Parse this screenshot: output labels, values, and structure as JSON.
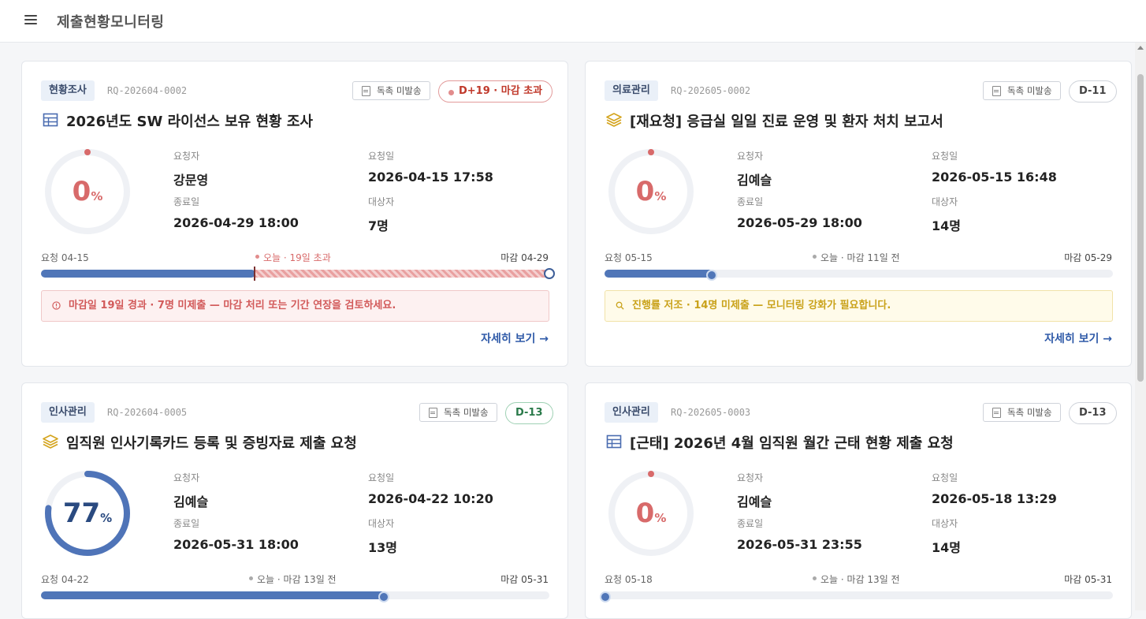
{
  "header": {
    "title": "제출현황모니터링",
    "menu_icon": "hamburger-menu-icon"
  },
  "common": {
    "doc_button": "독촉 미발송",
    "detail_link": "자세히 보기 →",
    "pct_unit": "%"
  },
  "cards": [
    {
      "category": "현황조사",
      "req_id": "RQ-202604-0002",
      "dday": "D+19 · 마감 초과",
      "title": "2026년도 SW 라이선스 보유 현황 조사",
      "title_icon": "table-icon",
      "progress": 0,
      "requester_label": "요청자",
      "requester": "강문영",
      "request_date_label": "요청일",
      "request_date": "2026-04-15 17:58",
      "end_date_label": "종료일",
      "end_date": "2026-04-29 18:00",
      "target_label": "대상자",
      "target": "7명",
      "timeline_start": "요청 04-15",
      "timeline_today": "오늘 · 19일 초과",
      "timeline_end": "마감 04-29",
      "alert": "마감일 19일 경과 · 7명 미제출 — 마감 처리 또는 기간 연장을 검토하세요.",
      "alert_icon": "info-circle-icon"
    },
    {
      "category": "의료관리",
      "req_id": "RQ-202605-0002",
      "dday": "D-11",
      "title": "[재요청] 응급실 일일 진료 운영 및 환자 처치 보고서",
      "title_icon": "layers-icon",
      "progress": 0,
      "requester_label": "요청자",
      "requester": "김예슬",
      "request_date_label": "요청일",
      "request_date": "2026-05-15 16:48",
      "end_date_label": "종료일",
      "end_date": "2026-05-29 18:00",
      "target_label": "대상자",
      "target": "14명",
      "timeline_start": "요청 05-15",
      "timeline_today": "오늘 · 마감 11일 전",
      "timeline_end": "마감 05-29",
      "alert": "진행률 저조 · 14명 미제출 — 모니터링 강화가 필요합니다.",
      "alert_icon": "search-icon"
    },
    {
      "category": "인사관리",
      "req_id": "RQ-202604-0005",
      "dday": "D-13",
      "title": "임직원 인사기록카드 등록 및 증빙자료 제출 요청",
      "title_icon": "layers-icon",
      "progress": 77,
      "requester_label": "요청자",
      "requester": "김예슬",
      "request_date_label": "요청일",
      "request_date": "2026-04-22 10:20",
      "end_date_label": "종료일",
      "end_date": "2026-05-31 18:00",
      "target_label": "대상자",
      "target": "13명",
      "timeline_start": "요청 04-22",
      "timeline_today": "오늘 · 마감 13일 전",
      "timeline_end": "마감 05-31"
    },
    {
      "category": "인사관리",
      "req_id": "RQ-202605-0003",
      "dday": "D-13",
      "title": "[근태] 2026년 4월 임직원 월간 근태 현황 제출 요청",
      "title_icon": "table-icon",
      "progress": 0,
      "requester_label": "요청자",
      "requester": "김예슬",
      "request_date_label": "요청일",
      "request_date": "2026-05-18 13:29",
      "end_date_label": "종료일",
      "end_date": "2026-05-31 23:55",
      "target_label": "대상자",
      "target": "14명",
      "timeline_start": "요청 05-18",
      "timeline_today": "오늘 · 마감 13일 전",
      "timeline_end": "마감 05-31"
    }
  ]
}
